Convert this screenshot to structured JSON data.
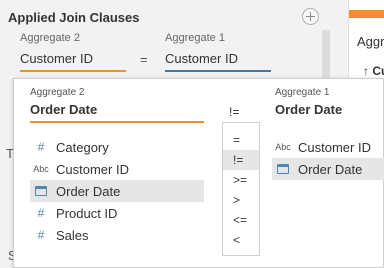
{
  "panel": {
    "title": "Applied Join Clauses",
    "clause": {
      "left_caption": "Aggregate 2",
      "left_value": "Customer ID",
      "operator": "=",
      "right_caption": "Aggregate 1",
      "right_value": "Customer ID"
    },
    "partial_marks": [
      "T",
      "S"
    ]
  },
  "right_pane": {
    "partial_text": "Aggre",
    "partial_sort": "↑ Cu"
  },
  "popup": {
    "left": {
      "caption": "Aggregate 2",
      "title": "Order Date",
      "fields": [
        {
          "icon": "#",
          "type": "number",
          "label": "Category"
        },
        {
          "icon": "Abc",
          "type": "string",
          "label": "Customer ID"
        },
        {
          "icon": "calendar",
          "type": "date",
          "label": "Order Date",
          "selected": true
        },
        {
          "icon": "#",
          "type": "number",
          "label": "Product ID"
        },
        {
          "icon": "#",
          "type": "number",
          "label": "Sales"
        }
      ]
    },
    "operator": {
      "current": "!=",
      "options": [
        "=",
        "!=",
        ">=",
        ">",
        "<=",
        "<"
      ],
      "selected": "!="
    },
    "right": {
      "caption": "Aggregate 1",
      "title": "Order Date",
      "fields": [
        {
          "icon": "Abc",
          "type": "string",
          "label": "Customer ID"
        },
        {
          "icon": "calendar",
          "type": "date",
          "label": "Order Date",
          "selected": true
        }
      ]
    }
  },
  "colors": {
    "accent_orange": "#f28e2b",
    "accent_blue": "#3d7ca6",
    "selection_gray": "#e6e6e6"
  }
}
